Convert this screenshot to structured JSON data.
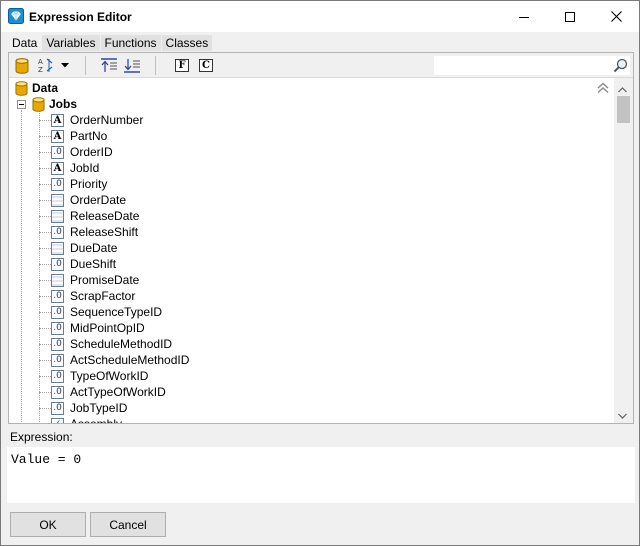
{
  "window": {
    "title": "Expression Editor",
    "controls": {
      "minimize": "minimize",
      "maximize": "maximize",
      "close": "close"
    }
  },
  "tabs": [
    {
      "label": "Data",
      "active": true
    },
    {
      "label": "Variables",
      "active": false
    },
    {
      "label": "Functions",
      "active": false
    },
    {
      "label": "Classes",
      "active": false
    }
  ],
  "toolbar": {
    "database_icon": "database-icon",
    "sort_icon": "sort-az-icon",
    "move_top_icon": "move-top-icon",
    "move_bottom_icon": "move-bottom-icon",
    "field_button": "F",
    "class_button": "C",
    "search_value": "",
    "search_placeholder": ""
  },
  "tree": {
    "root_label": "Data",
    "group_label": "Jobs",
    "items": [
      {
        "label": "OrderNumber",
        "type": "text"
      },
      {
        "label": "PartNo",
        "type": "text"
      },
      {
        "label": "OrderID",
        "type": "number"
      },
      {
        "label": "JobId",
        "type": "text"
      },
      {
        "label": "Priority",
        "type": "number"
      },
      {
        "label": "OrderDate",
        "type": "date"
      },
      {
        "label": "ReleaseDate",
        "type": "date"
      },
      {
        "label": "ReleaseShift",
        "type": "number"
      },
      {
        "label": "DueDate",
        "type": "date"
      },
      {
        "label": "DueShift",
        "type": "number"
      },
      {
        "label": "PromiseDate",
        "type": "date"
      },
      {
        "label": "ScrapFactor",
        "type": "number"
      },
      {
        "label": "SequenceTypeID",
        "type": "number"
      },
      {
        "label": "MidPointOpID",
        "type": "number"
      },
      {
        "label": "ScheduleMethodID",
        "type": "number"
      },
      {
        "label": "ActScheduleMethodID",
        "type": "number"
      },
      {
        "label": "TypeOfWorkID",
        "type": "number"
      },
      {
        "label": "ActTypeOfWorkID",
        "type": "number"
      },
      {
        "label": "JobTypeID",
        "type": "number"
      },
      {
        "label": "Assembly",
        "type": "bool"
      }
    ]
  },
  "type_glyphs": {
    "text": "A",
    "number": ".0",
    "date": "",
    "bool": "✓"
  },
  "expression": {
    "label": "Expression:",
    "value": "Value = 0"
  },
  "buttons": {
    "ok": "OK",
    "cancel": "Cancel"
  },
  "colors": {
    "db_icon": "#e6a700",
    "title_icon": "#1a8fd6"
  }
}
